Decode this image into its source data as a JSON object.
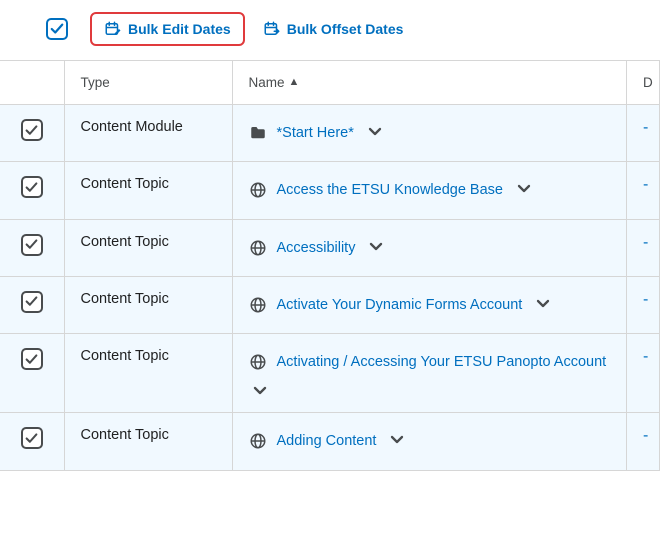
{
  "toolbar": {
    "bulk_edit_label": "Bulk Edit Dates",
    "bulk_offset_label": "Bulk Offset Dates"
  },
  "headers": {
    "type": "Type",
    "name": "Name",
    "due": "D"
  },
  "rows": [
    {
      "type": "Content Module",
      "name": "*Start Here*",
      "icon": "folder",
      "due": "-"
    },
    {
      "type": "Content Topic",
      "name": "Access the ETSU Knowledge Base",
      "icon": "globe",
      "due": "-"
    },
    {
      "type": "Content Topic",
      "name": "Accessibility",
      "icon": "globe",
      "due": "-"
    },
    {
      "type": "Content Topic",
      "name": "Activate Your Dynamic Forms Account",
      "icon": "globe",
      "due": "-"
    },
    {
      "type": "Content Topic",
      "name": "Activating / Accessing Your ETSU Panopto Account",
      "icon": "globe",
      "due": "-"
    },
    {
      "type": "Content Topic",
      "name": "Adding Content",
      "icon": "globe",
      "due": "-"
    }
  ]
}
